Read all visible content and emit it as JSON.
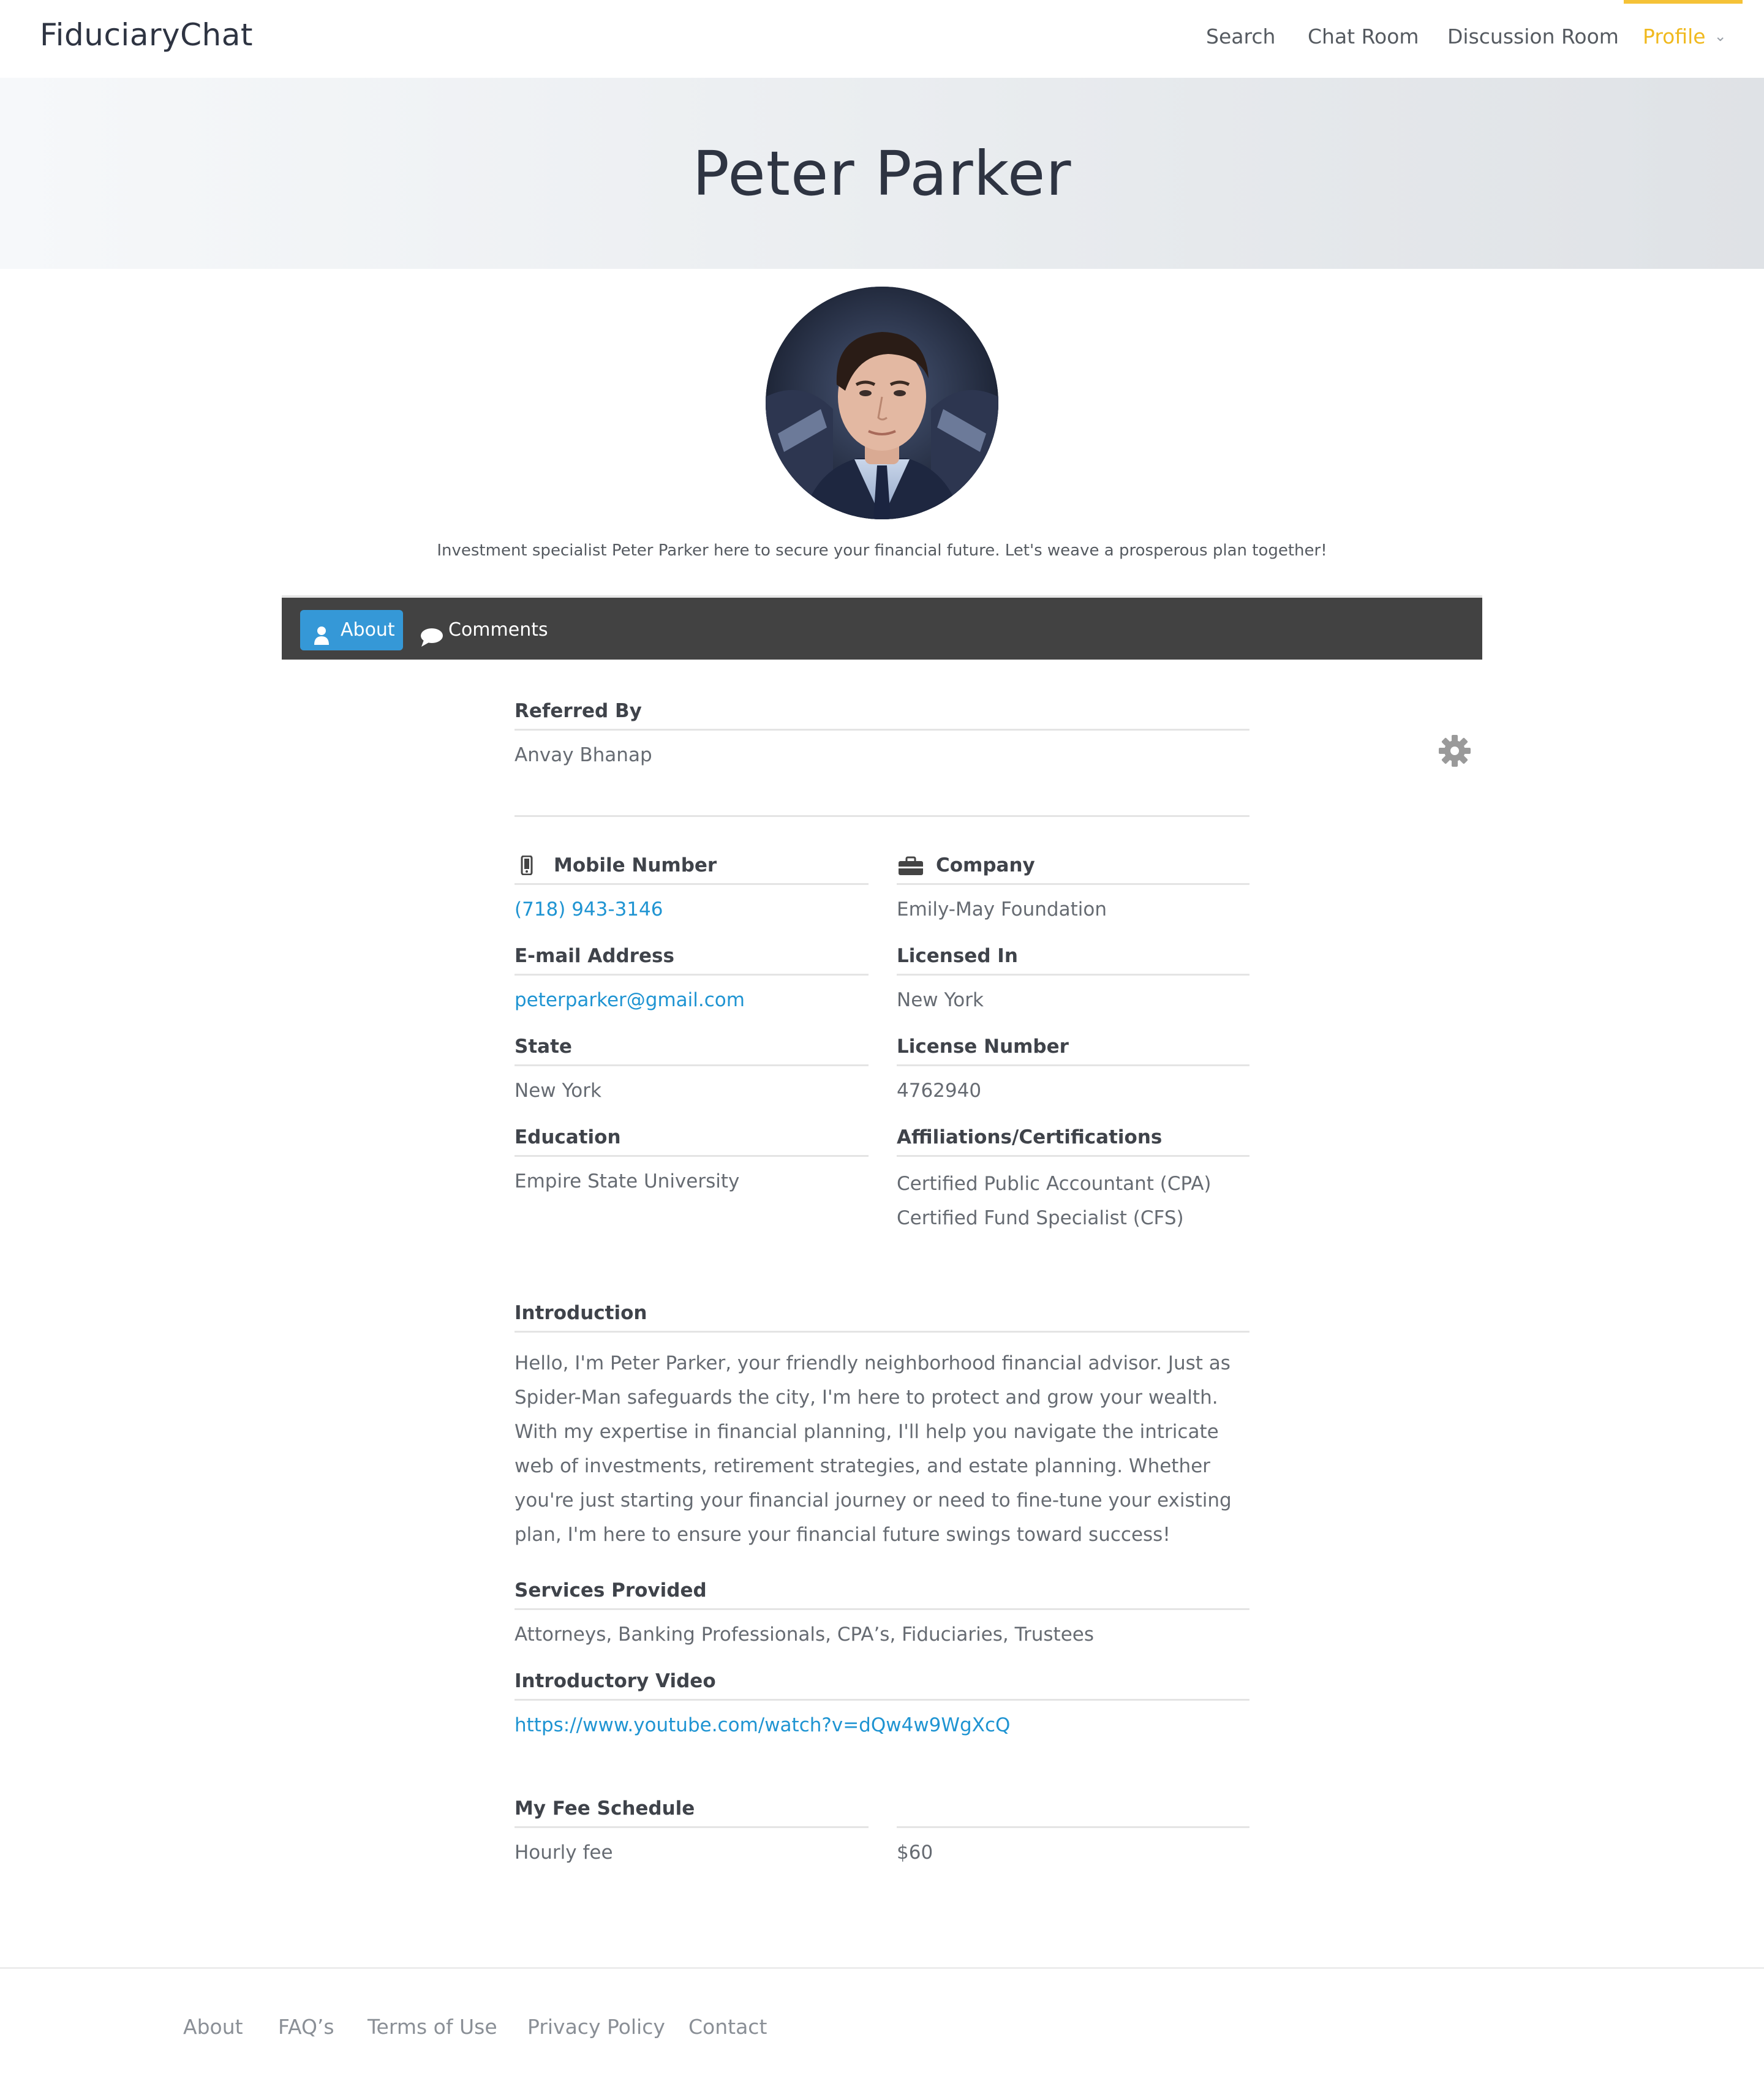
{
  "app": {
    "brand": "FiduciaryChat"
  },
  "nav": {
    "search": "Search",
    "chat_room": "Chat Room",
    "discussion_room": "Discussion Room",
    "profile": "Profile",
    "active_color": "#f0b91e"
  },
  "profile": {
    "name": "Peter Parker",
    "tagline": "Investment specialist Peter Parker here to secure your financial future. Let's weave a prosperous plan together!"
  },
  "tabs": {
    "about": "About",
    "comments": "Comments",
    "active_color": "#3598d7"
  },
  "referred": {
    "label": "Referred By",
    "value": "Anvay Bhanap"
  },
  "details": {
    "mobile_label": "Mobile Number",
    "mobile_value": "(718) 943-3146",
    "company_label": "Company",
    "company_value": "Emily-May Foundation",
    "email_label": "E-mail Address",
    "email_value": "peterparker@gmail.com",
    "licensed_label": "Licensed In",
    "licensed_value": "New York",
    "state_label": "State",
    "state_value": "New York",
    "license_number_label": "License Number",
    "license_number_value": "4762940",
    "education_label": "Education",
    "education_value": "Empire State University",
    "affiliations_label": "Affiliations/Certifications",
    "affiliations": [
      "Certified Public Accountant (CPA)",
      "Certified Fund Specialist (CFS)"
    ]
  },
  "introduction": {
    "label": "Introduction",
    "text": "Hello, I'm Peter Parker, your friendly neighborhood financial advisor. Just as Spider-Man safeguards the city, I'm here to protect and grow your wealth. With my expertise in financial planning, I'll help you navigate the intricate web of investments, retirement strategies, and estate planning. Whether you're just starting your financial journey or need to fine-tune your existing plan, I'm here to ensure your financial future swings toward success!"
  },
  "services": {
    "label": "Services Provided",
    "value": "Attorneys, Banking Professionals, CPA’s, Fiduciaries, Trustees"
  },
  "video": {
    "label": "Introductory Video",
    "url": "https://www.youtube.com/watch?v=dQw4w9WgXcQ"
  },
  "fees": {
    "label": "My Fee Schedule",
    "type": "Hourly fee",
    "amount": "$60"
  },
  "footer": {
    "about": "About",
    "faqs": "FAQ’s",
    "terms": "Terms of Use",
    "privacy": "Privacy Policy",
    "contact": "Contact"
  },
  "icons": [
    "user-icon",
    "comment-bubble-icon",
    "gear-icon",
    "mobile-phone-icon",
    "briefcase-icon",
    "chevron-down-icon"
  ]
}
